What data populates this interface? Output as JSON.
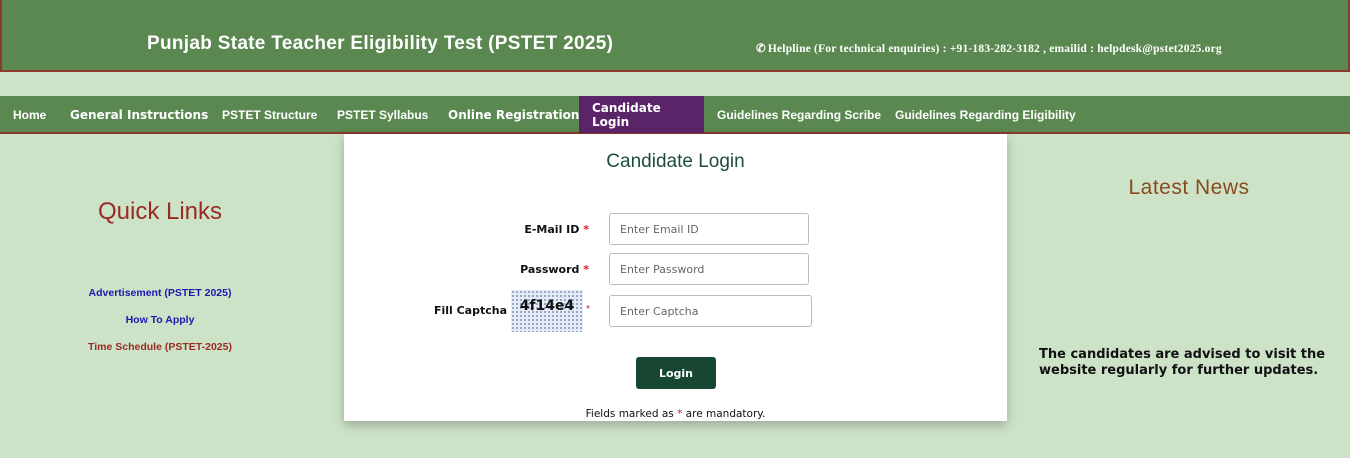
{
  "header": {
    "title": "Punjab State Teacher Eligibility Test (PSTET 2025)",
    "helpline": "Helpline (For technical enquiries) : +91-183-282-3182 , emailid : helpdesk@pstet2025.org"
  },
  "nav": {
    "items": [
      {
        "label": "Home"
      },
      {
        "label": "General Instructions"
      },
      {
        "label": "PSTET Structure"
      },
      {
        "label": "PSTET Syllabus"
      },
      {
        "label": "Online Registration"
      },
      {
        "label": "Candidate Login"
      },
      {
        "label": "Guidelines Regarding Scribe"
      },
      {
        "label": "Guidelines Regarding Eligibility"
      }
    ],
    "active": "Candidate Login"
  },
  "quick_links": {
    "title": "Quick Links",
    "links": [
      {
        "label": "Advertisement (PSTET 2025)"
      },
      {
        "label": "How To Apply"
      },
      {
        "label": "Time Schedule (PSTET-2025)"
      }
    ]
  },
  "login": {
    "title": "Candidate Login",
    "email_label": "E-Mail ID",
    "email_placeholder": "Enter Email ID",
    "password_label": "Password",
    "password_placeholder": "Enter Password",
    "captcha_label": "Fill Captcha",
    "captcha_code": "4f14e4",
    "captcha_placeholder": "Enter Captcha",
    "required_mark": "*",
    "button_label": "Login",
    "note_before": "Fields marked as ",
    "note_after": " are mandatory."
  },
  "news": {
    "title": "Latest News",
    "text": "The candidates are advised to visit the website regularly for further updates."
  },
  "colors": {
    "header_bg": "#5a8850",
    "active_nav": "#5c2468",
    "page_bg": "#cde3c8",
    "button_bg": "#174733"
  }
}
